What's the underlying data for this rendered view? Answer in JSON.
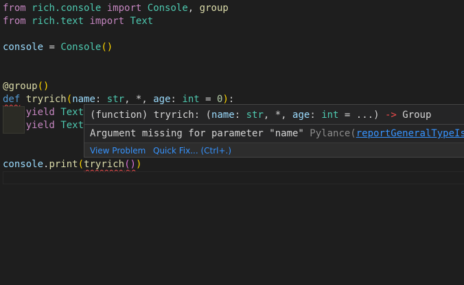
{
  "code": {
    "line1": {
      "kw_from": "from",
      "module": "rich.console",
      "kw_import": "import",
      "name1": "Console",
      "comma": ",",
      "name2": "group"
    },
    "line2": {
      "kw_from": "from",
      "module": "rich.text",
      "kw_import": "import",
      "name1": "Text"
    },
    "line4": {
      "var": "console",
      "eq": "=",
      "cls": "Console",
      "open": "(",
      "close": ")"
    },
    "line7": {
      "at": "@",
      "decorator": "group",
      "open": "(",
      "close": ")"
    },
    "line8": {
      "kw_def": "def",
      "fn": "tryrich",
      "open": "(",
      "p1": "name",
      "c1": ":",
      "t1": "str",
      "mid": ", *, ",
      "p2": "age",
      "c2": ":",
      "t2": "int",
      "eq": "=",
      "default": "0",
      "close": ")",
      "colon": ":"
    },
    "line9": {
      "kw": "yield",
      "cls": "Text"
    },
    "line10": {
      "kw": "yield",
      "cls": "Text"
    },
    "line12": {
      "var": "console",
      "dot": ".",
      "fn": "print",
      "open": "(",
      "call": "tryrich",
      "open2": "(",
      "close2": ")",
      "close": ")"
    }
  },
  "hover": {
    "sig_prefix": "(function) tryrich: (",
    "sig_p1": "name",
    "sig_c1": ": ",
    "sig_t1": "str",
    "sig_mid": ", *, ",
    "sig_p2": "age",
    "sig_c2": ": ",
    "sig_t2": "int",
    "sig_rest": " = ...) ",
    "sig_arrow": "->",
    "sig_ret": " Group",
    "diagnostic": "Argument missing for parameter \"name\"",
    "source": " Pylance(",
    "rule": "reportGeneralTypeIs",
    "view_problem": "View Problem",
    "quick_fix": "Quick Fix... (Ctrl+.)"
  },
  "colors": {
    "background": "#1e1e1e",
    "error": "#f14c4c",
    "link": "#3794ff"
  }
}
